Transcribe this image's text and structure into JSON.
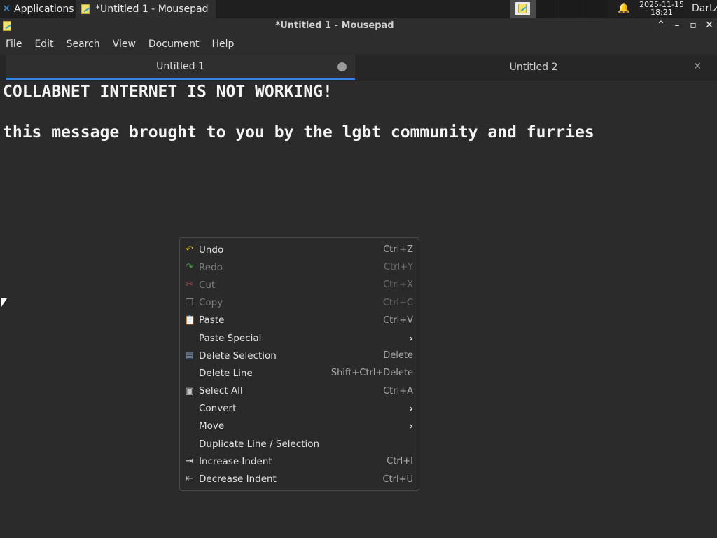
{
  "panel": {
    "applications_label": "Applications",
    "separator": "⋮",
    "task_label": "*Untitled 1 - Mousepad",
    "clock_date": "2025-11-15",
    "clock_time": "18:21",
    "user": "Dartz"
  },
  "window": {
    "title": "*Untitled 1 - Mousepad"
  },
  "menubar": [
    "File",
    "Edit",
    "Search",
    "View",
    "Document",
    "Help"
  ],
  "tabs": [
    {
      "label": "Untitled 1",
      "active": true,
      "modified": true
    },
    {
      "label": "Untitled 2",
      "active": false,
      "modified": false
    }
  ],
  "editor": {
    "lines": [
      "COLLABNET INTERNET IS NOT WORKING!",
      "",
      "this message brought to you by the lgbt community and furries"
    ]
  },
  "context_menu": [
    {
      "label": "Undo",
      "accel": "Ctrl+Z",
      "icon": "undo-icon",
      "disabled": false
    },
    {
      "label": "Redo",
      "accel": "Ctrl+Y",
      "icon": "redo-icon",
      "disabled": true
    },
    {
      "label": "Cut",
      "accel": "Ctrl+X",
      "icon": "cut-icon",
      "disabled": true
    },
    {
      "label": "Copy",
      "accel": "Ctrl+C",
      "icon": "copy-icon",
      "disabled": true
    },
    {
      "label": "Paste",
      "accel": "Ctrl+V",
      "icon": "paste-icon",
      "disabled": false
    },
    {
      "label": "Paste Special",
      "accel": "",
      "icon": "",
      "submenu": true
    },
    {
      "label": "Delete Selection",
      "accel": "Delete",
      "icon": "delete-icon",
      "disabled": false
    },
    {
      "label": "Delete Line",
      "accel": "Shift+Ctrl+Delete",
      "icon": "",
      "disabled": false
    },
    {
      "label": "Select All",
      "accel": "Ctrl+A",
      "icon": "select-all-icon",
      "disabled": false
    },
    {
      "label": "Convert",
      "accel": "",
      "icon": "",
      "submenu": true
    },
    {
      "label": "Move",
      "accel": "",
      "icon": "",
      "submenu": true
    },
    {
      "label": "Duplicate Line / Selection",
      "accel": "",
      "icon": "",
      "disabled": false
    },
    {
      "label": "Increase Indent",
      "accel": "Ctrl+I",
      "icon": "increase-indent-icon",
      "disabled": false
    },
    {
      "label": "Decrease Indent",
      "accel": "Ctrl+U",
      "icon": "decrease-indent-icon",
      "disabled": false
    }
  ],
  "colors": {
    "tab_accent": "#3584e4",
    "background": "#2b2b2b"
  }
}
